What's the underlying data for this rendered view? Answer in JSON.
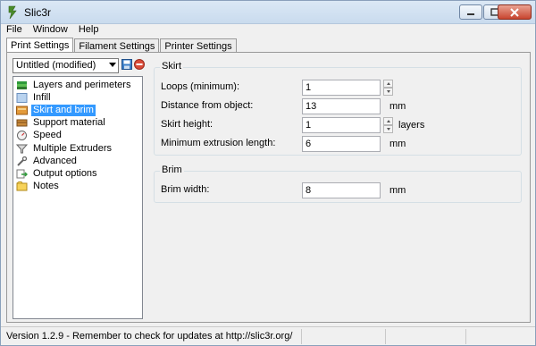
{
  "window": {
    "title": "Slic3r"
  },
  "menu": {
    "file": "File",
    "window": "Window",
    "help": "Help"
  },
  "tabs": [
    "Print Settings",
    "Filament Settings",
    "Printer Settings"
  ],
  "preset": {
    "selected": "Untitled (modified)"
  },
  "categories": [
    {
      "label": "Layers and perimeters",
      "icon": "layers-icon"
    },
    {
      "label": "Infill",
      "icon": "infill-icon"
    },
    {
      "label": "Skirt and brim",
      "icon": "skirt-icon"
    },
    {
      "label": "Support material",
      "icon": "support-icon"
    },
    {
      "label": "Speed",
      "icon": "speed-icon"
    },
    {
      "label": "Multiple Extruders",
      "icon": "extruders-icon"
    },
    {
      "label": "Advanced",
      "icon": "wrench-icon"
    },
    {
      "label": "Output options",
      "icon": "output-icon"
    },
    {
      "label": "Notes",
      "icon": "notes-icon"
    }
  ],
  "skirt": {
    "title": "Skirt",
    "loops_label": "Loops (minimum):",
    "loops_value": "1",
    "distance_label": "Distance from object:",
    "distance_value": "13",
    "distance_unit": "mm",
    "height_label": "Skirt height:",
    "height_value": "1",
    "height_unit": "layers",
    "min_extrusion_label": "Minimum extrusion length:",
    "min_extrusion_value": "6",
    "min_extrusion_unit": "mm"
  },
  "brim": {
    "title": "Brim",
    "width_label": "Brim width:",
    "width_value": "8",
    "width_unit": "mm"
  },
  "status": {
    "text": "Version 1.2.9 - Remember to check for updates at http://slic3r.org/"
  },
  "colors": {
    "selection": "#3399ff",
    "titlebar": "#dbe8f5"
  }
}
